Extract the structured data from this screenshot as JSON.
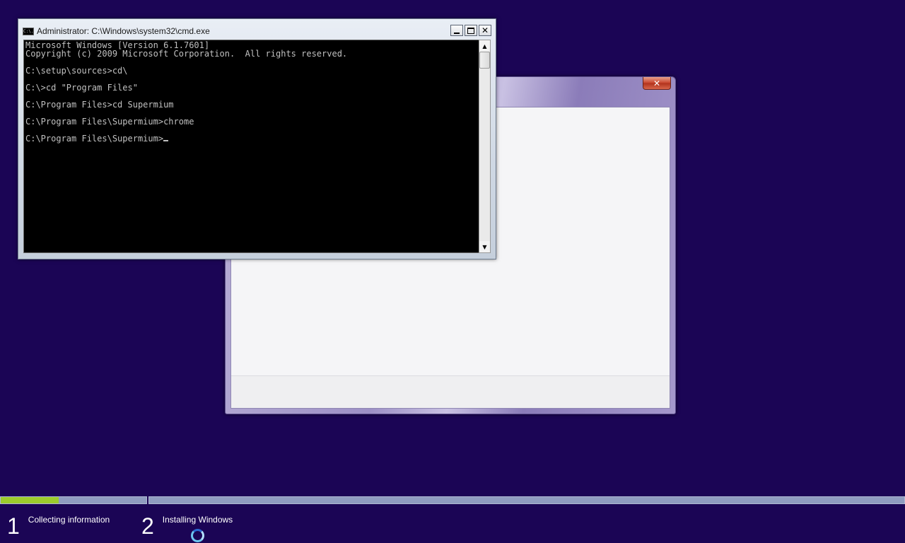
{
  "cmd_window": {
    "title": "Administrator: C:\\Windows\\system32\\cmd.exe",
    "icon_text": "C:\\.",
    "controls": {
      "minimize": "",
      "maximize": "",
      "close": "✕"
    },
    "lines": [
      "Microsoft Windows [Version 6.1.7601]",
      "Copyright (c) 2009 Microsoft Corporation.  All rights reserved.",
      "",
      "C:\\setup\\sources>cd\\",
      "",
      "C:\\>cd \"Program Files\"",
      "",
      "C:\\Program Files>cd Supermium",
      "",
      "C:\\Program Files\\Supermium>chrome",
      "",
      "C:\\Program Files\\Supermium>"
    ],
    "scroll_up": "▲",
    "scroll_down": "▼"
  },
  "setup_window": {
    "close_label": "✕"
  },
  "steps": [
    {
      "number": "1",
      "label": "Collecting information"
    },
    {
      "number": "2",
      "label": "Installing Windows"
    }
  ],
  "progress": {
    "step1_fraction": 0.4,
    "step2_fraction": 0.0
  },
  "colors": {
    "desktop_background": "#1b0555",
    "progress_fill": "#9ccc2c",
    "console_text": "#c0c0c0"
  }
}
